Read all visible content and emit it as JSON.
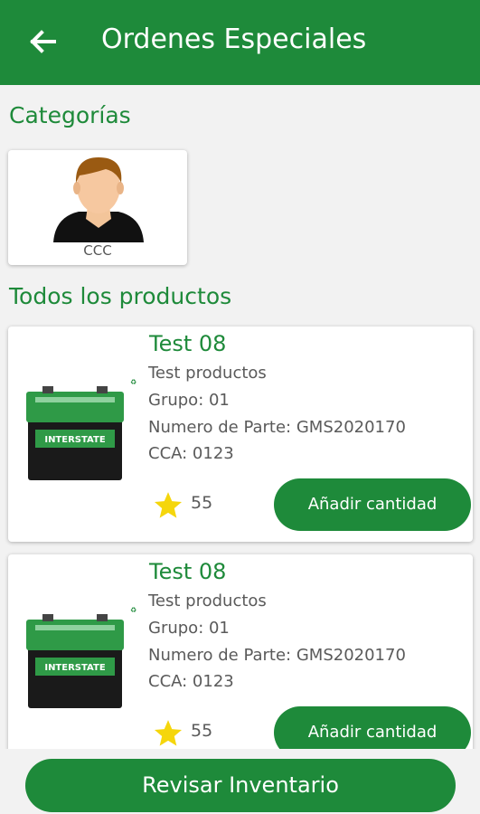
{
  "app_bar": {
    "title": "Ordenes Especiales",
    "back_icon": "arrow-left-icon",
    "color": "#1e8a3a"
  },
  "categories": {
    "heading": "Categorías",
    "items": [
      {
        "label": "CCC",
        "icon": "person-avatar-icon"
      }
    ]
  },
  "products": {
    "heading": "Todos los productos",
    "items": [
      {
        "name": "Test 08",
        "description": "Test productos",
        "group": "Grupo: 01",
        "part_number": "Numero de Parte: GMS2020170",
        "cca": "CCA: 0123",
        "rating": "55",
        "button_label": "Añadir cantidad",
        "image_brand": "INTERSTATE"
      },
      {
        "name": "Test 08",
        "description": "Test productos",
        "group": "Grupo: 01",
        "part_number": "Numero de Parte: GMS2020170",
        "cca": "CCA: 0123",
        "rating": "55",
        "button_label": "Añadir cantidad",
        "image_brand": "INTERSTATE"
      }
    ]
  },
  "footer": {
    "button_label": "Revisar Inventario"
  },
  "colors": {
    "primary": "#1e8a3a",
    "star": "#f5d60c",
    "background": "#f2f2f2"
  }
}
